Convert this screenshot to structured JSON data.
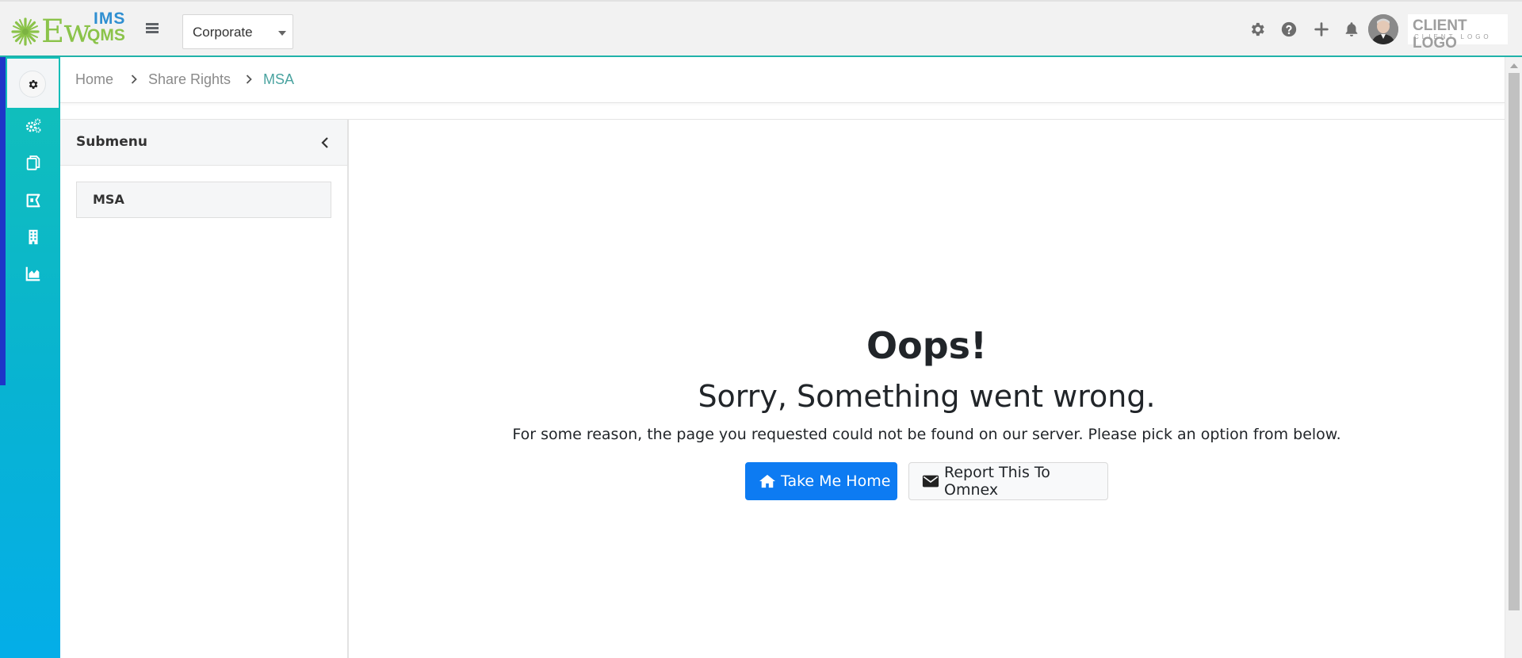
{
  "header": {
    "logo": {
      "main_text": "Ew",
      "top_text": "IMS",
      "bottom_text": "QMS"
    },
    "org_select": {
      "value": "Corporate"
    },
    "icons": [
      "gear-icon",
      "help-icon",
      "plus-icon",
      "bell-icon"
    ],
    "client_logo": {
      "line1": "CLIENT LOGO",
      "line2": "CLIENT LOGO"
    }
  },
  "rail": {
    "items": [
      "settings-icon",
      "cogs-icon",
      "copy-icon",
      "ticket-icon",
      "building-icon",
      "area-chart-icon"
    ]
  },
  "breadcrumb": {
    "items": [
      "Home",
      "Share Rights",
      "MSA"
    ]
  },
  "submenu": {
    "title": "Submenu",
    "items": [
      "MSA"
    ]
  },
  "error": {
    "title": "Oops!",
    "subtitle": "Sorry, Something went wrong.",
    "message": "For some reason, the page you requested could not be found on our server. Please pick an option from below.",
    "home_button": "Take Me Home",
    "report_button": "Report This To Omnex"
  },
  "colors": {
    "accent": "#20b2aa",
    "primary_button": "#0d7bf2",
    "rail_active": "#1e35c8",
    "breadcrumb_active": "#4aa3a0"
  }
}
